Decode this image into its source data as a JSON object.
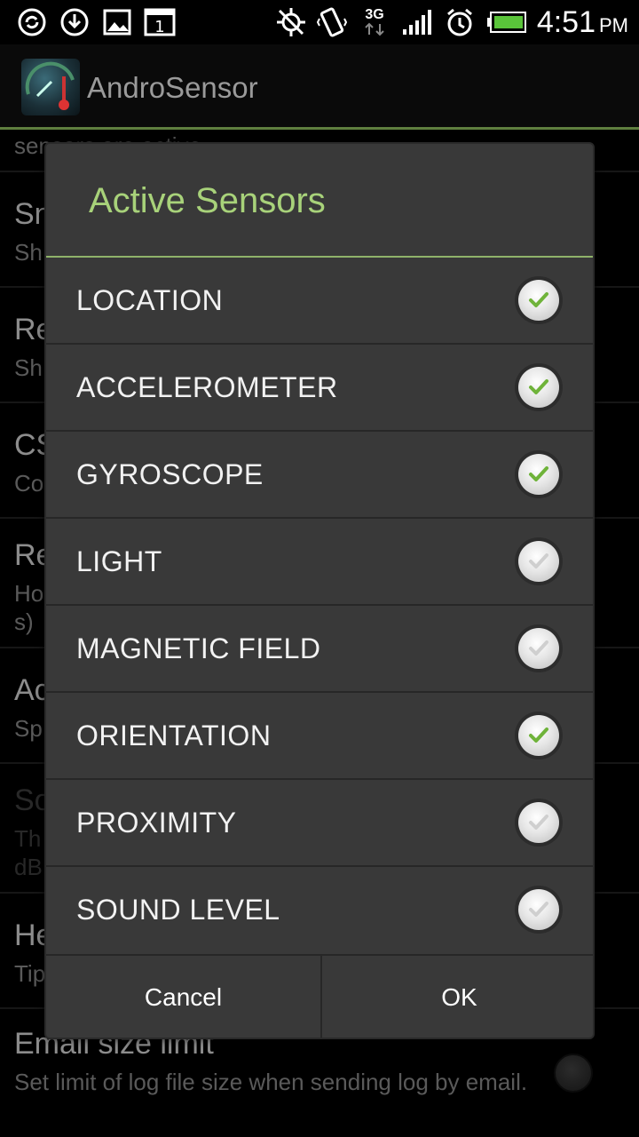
{
  "status_bar": {
    "time": "4:51",
    "ampm": "PM",
    "network": "3G",
    "icons": [
      "sync-icon",
      "download-icon",
      "image-icon",
      "calendar-icon",
      "gps-off-icon",
      "vibrate-icon",
      "network-3g-icon",
      "signal-icon",
      "alarm-icon",
      "battery-icon"
    ],
    "calendar_day": "1"
  },
  "app": {
    "title": "AndroSensor"
  },
  "background_prefs": [
    {
      "title": "",
      "summary": "sensors are active"
    },
    {
      "title": "Sn",
      "summary": "Sh"
    },
    {
      "title": "Re",
      "summary": "Sh"
    },
    {
      "title": "CS",
      "summary": "Co"
    },
    {
      "title": "Re",
      "summary": "Ho\ns)"
    },
    {
      "title": "Ac",
      "summary": "Sp"
    },
    {
      "title": "So",
      "summary": "Th\ndB"
    },
    {
      "title": "He",
      "summary": "Tip"
    },
    {
      "title": "Email size limit",
      "summary": "Set limit of log file size when sending log by email."
    }
  ],
  "dialog": {
    "title": "Active Sensors",
    "options": [
      {
        "label": "LOCATION",
        "checked": true
      },
      {
        "label": "ACCELEROMETER",
        "checked": true
      },
      {
        "label": "GYROSCOPE",
        "checked": true
      },
      {
        "label": "LIGHT",
        "checked": false
      },
      {
        "label": "MAGNETIC FIELD",
        "checked": false
      },
      {
        "label": "ORIENTATION",
        "checked": true
      },
      {
        "label": "PROXIMITY",
        "checked": false
      },
      {
        "label": "SOUND LEVEL",
        "checked": false
      }
    ],
    "cancel_label": "Cancel",
    "ok_label": "OK"
  },
  "colors": {
    "accent_green": "#a8d27a",
    "check_green": "#6fb33a",
    "check_gray": "#cfcfcf",
    "dialog_bg": "#393939"
  }
}
